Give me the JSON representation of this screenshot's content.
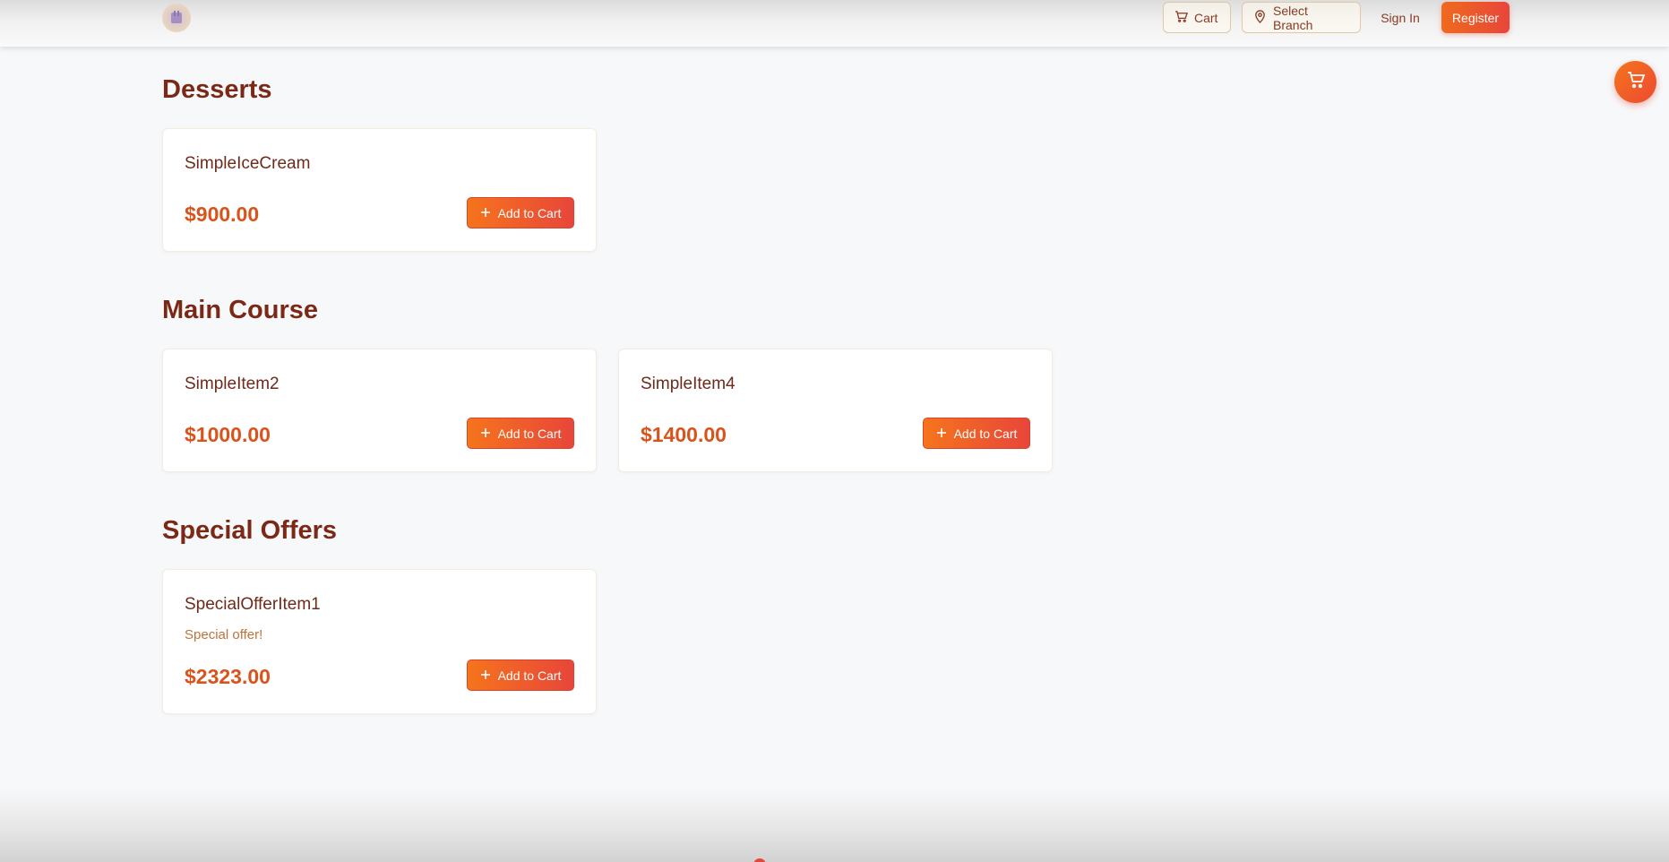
{
  "header": {
    "logo_icon": "restaurant-logo-icon",
    "cart_label": "Cart",
    "branch_label": "Select Branch",
    "signin_label": "Sign In",
    "register_label": "Register"
  },
  "fab": {
    "icon": "cart-icon"
  },
  "sections": [
    {
      "title": "Desserts",
      "items": [
        {
          "name": "SimpleIceCream",
          "price": "$900.00",
          "button": "Add to Cart"
        }
      ]
    },
    {
      "title": "Main Course",
      "items": [
        {
          "name": "SimpleItem2",
          "price": "$1000.00",
          "button": "Add to Cart"
        },
        {
          "name": "SimpleItem4",
          "price": "$1400.00",
          "button": "Add to Cart"
        }
      ]
    },
    {
      "title": "Special Offers",
      "items": [
        {
          "name": "SpecialOfferItem1",
          "description": "Special offer!",
          "price": "$2323.00",
          "button": "Add to Cart"
        }
      ]
    }
  ],
  "colors": {
    "accent_start": "#f5741c",
    "accent_end": "#e8463a",
    "heading": "#7c2816",
    "price": "#d9531c"
  }
}
